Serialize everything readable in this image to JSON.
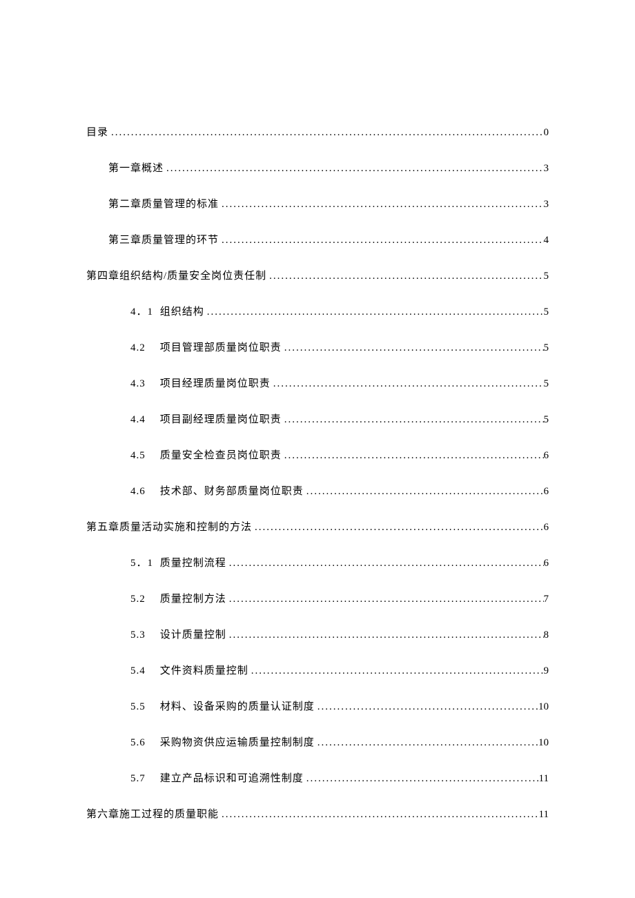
{
  "toc": [
    {
      "indent": 0,
      "label": "目录",
      "page": "0"
    },
    {
      "indent": 1,
      "label": "第一章概述",
      "page": "3"
    },
    {
      "indent": 1,
      "label": "第二章质量管理的标准",
      "page": "3"
    },
    {
      "indent": 1,
      "label": "第三章质量管理的环节",
      "page": "4"
    },
    {
      "indent": 0,
      "label": "第四章组织结构/质量安全岗位责任制",
      "page": "5"
    },
    {
      "indent": 2,
      "num": "4．1",
      "label": "组织结构",
      "page": "5"
    },
    {
      "indent": 2,
      "num": "4.2",
      "label": "项目管理部质量岗位职责",
      "page": "5"
    },
    {
      "indent": 2,
      "num": "4.3",
      "label": "项目经理质量岗位职责",
      "page": "5"
    },
    {
      "indent": 2,
      "num": "4.4",
      "label": "项目副经理质量岗位职责",
      "page": "5"
    },
    {
      "indent": 2,
      "num": "4.5",
      "label": "质量安全检查员岗位职责",
      "page": "6"
    },
    {
      "indent": 2,
      "num": "4.6",
      "label": "技术部、财务部质量岗位职责",
      "page": "6"
    },
    {
      "indent": 0,
      "label": "第五章质量活动实施和控制的方法",
      "page": "6"
    },
    {
      "indent": 2,
      "num": "5．1",
      "label": "质量控制流程",
      "page": "6"
    },
    {
      "indent": 2,
      "num": "5.2",
      "label": "质量控制方法",
      "page": "7"
    },
    {
      "indent": 2,
      "num": "5.3",
      "label": "设计质量控制",
      "page": "8"
    },
    {
      "indent": 2,
      "num": "5.4",
      "label": "文件资料质量控制",
      "page": "9"
    },
    {
      "indent": 2,
      "num": "5.5",
      "label": "材料、设备采购的质量认证制度",
      "page": "10"
    },
    {
      "indent": 2,
      "num": "5.6",
      "label": "采购物资供应运输质量控制制度",
      "page": "10"
    },
    {
      "indent": 2,
      "num": "5.7",
      "label": "建立产品标识和可追溯性制度",
      "page": "11"
    },
    {
      "indent": 0,
      "label": "第六章施工过程的质量职能",
      "page": "11"
    }
  ]
}
